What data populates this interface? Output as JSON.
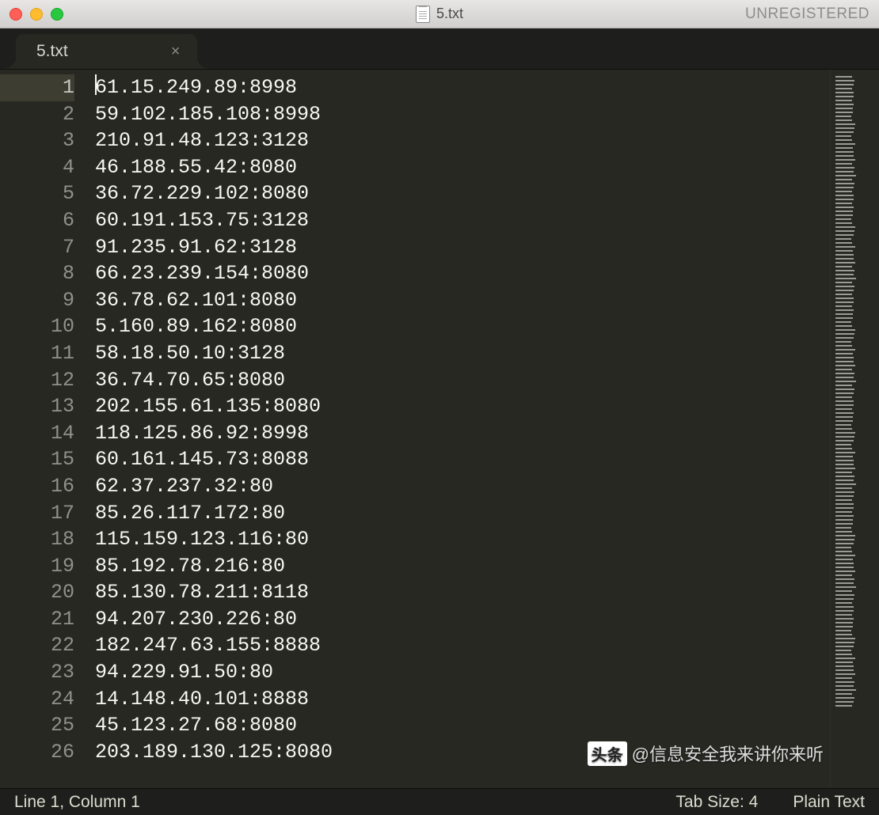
{
  "titlebar": {
    "filename": "5.txt",
    "status": "UNREGISTERED"
  },
  "tab": {
    "label": "5.txt",
    "close_glyph": "×"
  },
  "lines": [
    "61.15.249.89:8998",
    "59.102.185.108:8998",
    "210.91.48.123:3128",
    "46.188.55.42:8080",
    "36.72.229.102:8080",
    "60.191.153.75:3128",
    "91.235.91.62:3128",
    "66.23.239.154:8080",
    "36.78.62.101:8080",
    "5.160.89.162:8080",
    "58.18.50.10:3128",
    "36.74.70.65:8080",
    "202.155.61.135:8080",
    "118.125.86.92:8998",
    "60.161.145.73:8088",
    "62.37.237.32:80",
    "85.26.117.172:80",
    "115.159.123.116:80",
    "85.192.78.216:80",
    "85.130.78.211:8118",
    "94.207.230.226:80",
    "182.247.63.155:8888",
    "94.229.91.50:80",
    "14.148.40.101:8888",
    "45.123.27.68:8080",
    "203.189.130.125:8080"
  ],
  "statusbar": {
    "position": "Line 1, Column 1",
    "tabsize": "Tab Size: 4",
    "syntax": "Plain Text"
  },
  "watermark": {
    "logo": "头条",
    "text": "@信息安全我来讲你来听"
  }
}
